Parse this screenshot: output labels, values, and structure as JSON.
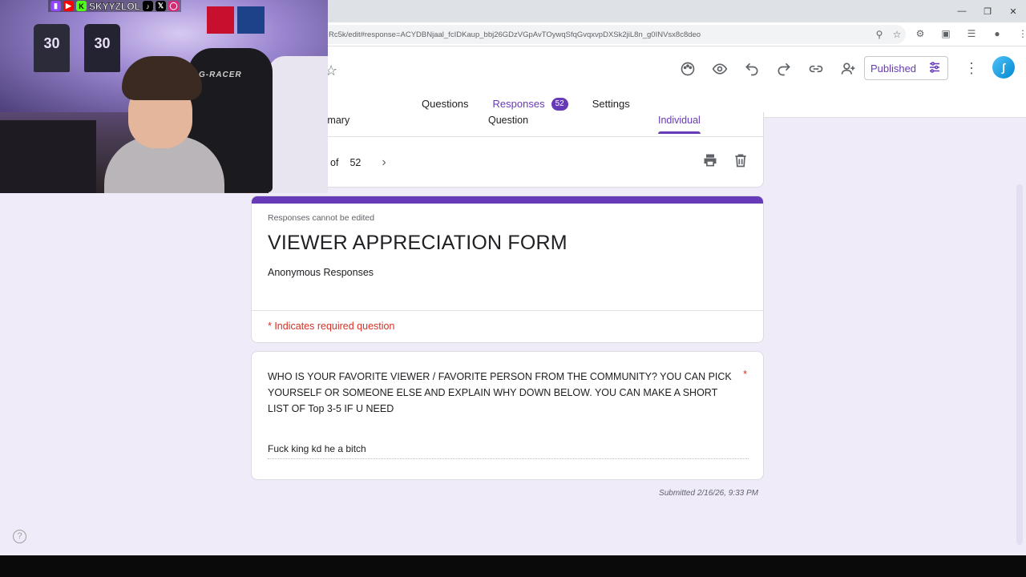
{
  "browser": {
    "url": "Rc5k/edit#response=ACYDBNjaal_fcIDKaup_bbj26GDzVGpAvTOywqSfqGvqxvpDXSk2jiL8n_g0INVsx8c8deo"
  },
  "header": {
    "published_label": "Published",
    "tabs": [
      {
        "label": "Questions"
      },
      {
        "label": "Responses",
        "badge": "52"
      },
      {
        "label": "Settings"
      }
    ]
  },
  "responses": {
    "subtabs": [
      "mmary",
      "Question",
      "Individual"
    ],
    "pager_of": "of",
    "pager_total": "52"
  },
  "form": {
    "note": "Responses cannot be edited",
    "title": "VIEWER APPRECIATION FORM",
    "description": "Anonymous Responses",
    "required_note": "* Indicates required question"
  },
  "question": {
    "text": "WHO IS YOUR FAVORITE VIEWER / FAVORITE PERSON FROM THE COMMUNITY? YOU CAN PICK YOURSELF OR SOMEONE ELSE AND EXPLAIN WHY DOWN BELOW. YOU CAN MAKE A SHORT LIST OF Top 3-5 IF U NEED",
    "required_marker": "*",
    "answer": "Fuck king kd he a bitch"
  },
  "submitted": "Submitted 2/16/26, 9:33 PM",
  "webcam": {
    "handle": "SKYYZLOL",
    "jersey_numbers": [
      "30",
      "30"
    ],
    "chair_brand": "G-RACER"
  },
  "colors": {
    "accent": "#673ab7",
    "background": "#f0ebf8",
    "required": "#d93025"
  }
}
